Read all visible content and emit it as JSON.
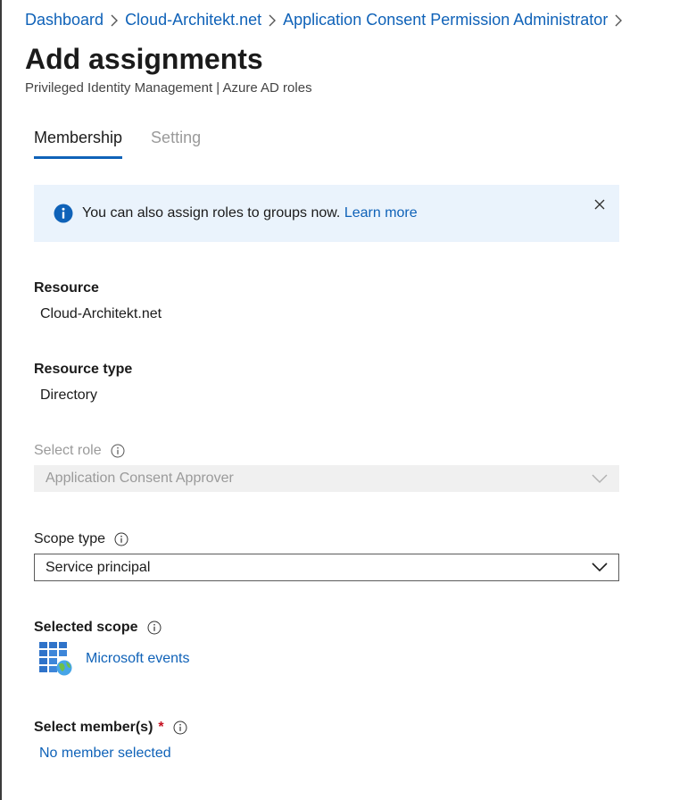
{
  "breadcrumb": {
    "items": [
      "Dashboard",
      "Cloud-Architekt.net",
      "Application Consent Permission Administrator"
    ]
  },
  "page": {
    "title": "Add assignments",
    "subtitle": "Privileged Identity Management | Azure AD roles"
  },
  "tabs": [
    {
      "label": "Membership",
      "active": true
    },
    {
      "label": "Setting",
      "active": false
    }
  ],
  "banner": {
    "text": "You can also assign roles to groups now.",
    "link": "Learn more",
    "icon": "info-icon",
    "close_icon": "close-icon"
  },
  "form": {
    "resource": {
      "label": "Resource",
      "value": "Cloud-Architekt.net"
    },
    "resource_type": {
      "label": "Resource type",
      "value": "Directory"
    },
    "select_role": {
      "label": "Select role",
      "value": "Application Consent Approver",
      "disabled": true
    },
    "scope_type": {
      "label": "Scope type",
      "value": "Service principal"
    },
    "selected_scope": {
      "label": "Selected scope",
      "value": "Microsoft events",
      "icon": "app-grid-globe-icon"
    },
    "select_members": {
      "label": "Select member(s)",
      "required_marker": "*",
      "value": "No member selected"
    }
  },
  "colors": {
    "link": "#0f62b8",
    "tab_underline": "#0f62b8",
    "banner_bg": "#eaf3fc",
    "required": "#c50f1f",
    "disabled_text": "#9a9a9a"
  }
}
